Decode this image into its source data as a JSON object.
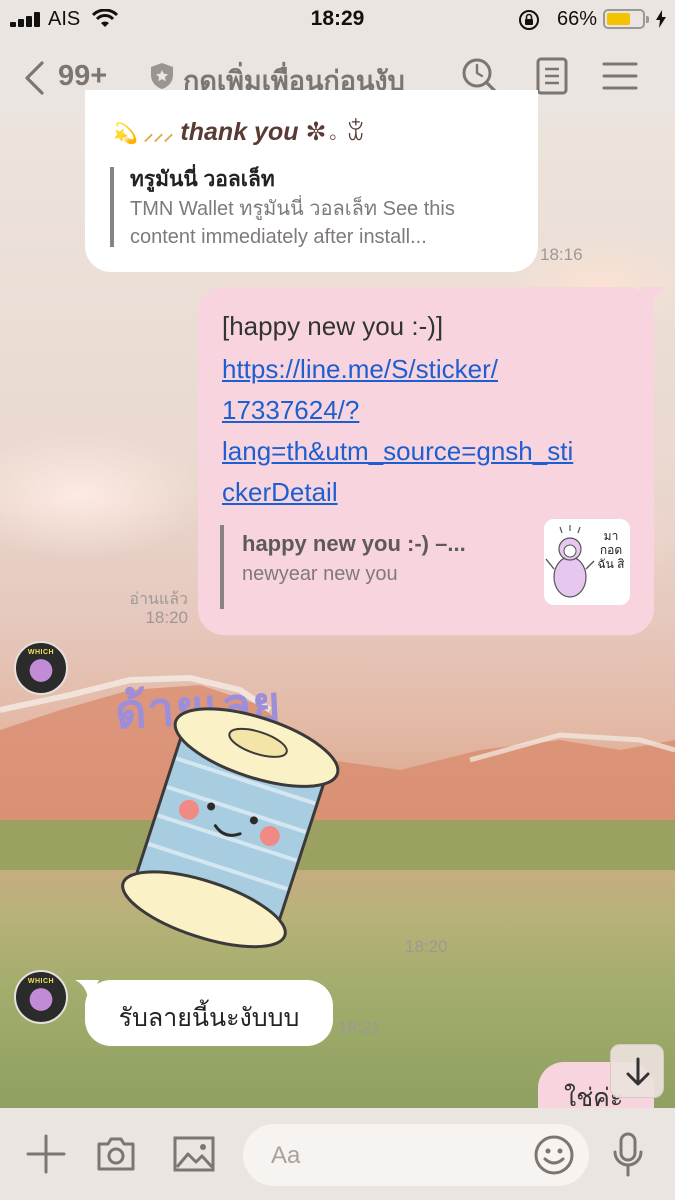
{
  "status_bar": {
    "carrier": "AIS",
    "time": "18:29",
    "battery_percent": "66%"
  },
  "header": {
    "back_count": "99+",
    "title": "กดเพิ่มเพื่อนก่อนงับ"
  },
  "messages": [
    {
      "direction": "incoming",
      "partial_text": "thank you",
      "decor_prefix": "💫 ⸝⸝⸝",
      "decor_suffix": "✼。ꒃ",
      "preview_title": "ทรูมันนี่ วอลเล็ท",
      "preview_desc": "TMN Wallet ทรูมันนี่ วอลเล็ท See this content immediately after install...",
      "time": "18:16"
    },
    {
      "direction": "outgoing",
      "text_line": "[happy new you :-)]",
      "link": "https://line.me/S/sticker/17337624/?lang=th&utm_source=gnsh_stickerDetail",
      "link_lines": [
        "https://line.me/S/sticker/",
        "17337624/?",
        "lang=th&utm_source=gnsh_sti",
        "ckerDetail"
      ],
      "preview_title": "happy new you :-) –...",
      "preview_desc": "newyear new you",
      "thumb_text": "มา กอด ฉัน สิ",
      "read_label": "อ่านแล้ว",
      "time": "18:20"
    },
    {
      "direction": "incoming",
      "type": "sticker",
      "sticker_text": "ด้ายเลย",
      "time": "18:20"
    },
    {
      "direction": "incoming",
      "text": "รับลายนี้นะงับบบ",
      "time": "18:21"
    },
    {
      "direction": "outgoing",
      "text": "ใช่ค่ะ"
    }
  ],
  "avatar_label": "WHICH",
  "input": {
    "placeholder": "Aa"
  },
  "icons": [
    "chevron-left-icon",
    "shield-icon",
    "search-icon",
    "notes-icon",
    "menu-icon",
    "plus-icon",
    "camera-icon",
    "image-icon",
    "emoji-icon",
    "microphone-icon",
    "arrow-down-icon"
  ],
  "colors": {
    "outgoing_bubble": "#f8d5de",
    "incoming_bubble": "#ffffff",
    "link": "#1d5fd1",
    "header_bg": "#ebe5e1",
    "battery": "#f4c200"
  }
}
